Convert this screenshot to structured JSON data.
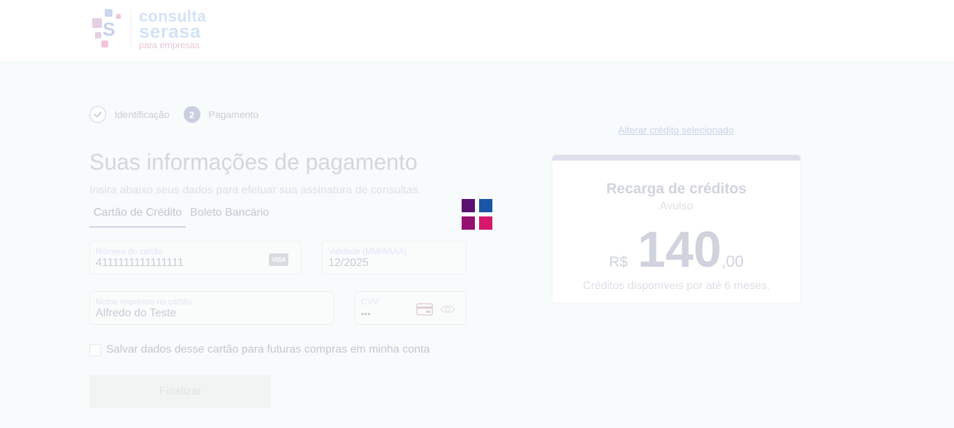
{
  "brand": {
    "line1": "consulta",
    "line2": "serasa",
    "line3": "para empresas"
  },
  "stepper": {
    "steps": [
      {
        "label": "Identificação",
        "state": "done"
      },
      {
        "number": "2",
        "label": "Pagamento",
        "state": "active"
      }
    ]
  },
  "main": {
    "title": "Suas informações de pagamento",
    "subtitle": "Insira abaixo seus dados para efetuar sua assinatura de consultas."
  },
  "tabs": [
    {
      "label": "Cartão de Crédito",
      "active": true
    },
    {
      "label": "Boleto Bancário",
      "active": false
    }
  ],
  "form": {
    "card_number": {
      "label": "Número do cartão",
      "value": "4111111111111111",
      "brand_badge": "VISA"
    },
    "validity": {
      "label": "Validade (MM/AAAA)",
      "value": "12/2025"
    },
    "name": {
      "label": "Nome impresso no cartão",
      "value": "Alfredo do Teste"
    },
    "cvv": {
      "label": "CVV",
      "value": "•••"
    },
    "save_card": {
      "label": "Salvar dados desse cartão para futuras compras em minha conta",
      "checked": false
    },
    "submit_label": "Finalizar"
  },
  "summary": {
    "change_link": "Alterar crédito selecionado",
    "title": "Recarga de créditos",
    "subtitle": "Avulso",
    "currency": "R$",
    "price_int": "140",
    "price_dec": ",00",
    "note": "Créditos disponíveis por até 6 meses."
  },
  "colors": {
    "loader": [
      "#5a1170",
      "#1b55a5",
      "#951170",
      "#d6176b"
    ],
    "accent": "#c9cfe1"
  },
  "icons": {
    "step_done": "check-circle-icon",
    "visa": "visa-icon",
    "cvv": "credit-card-icon",
    "toggle_visibility": "eye-icon",
    "loading": "loading-spinner-icon"
  }
}
